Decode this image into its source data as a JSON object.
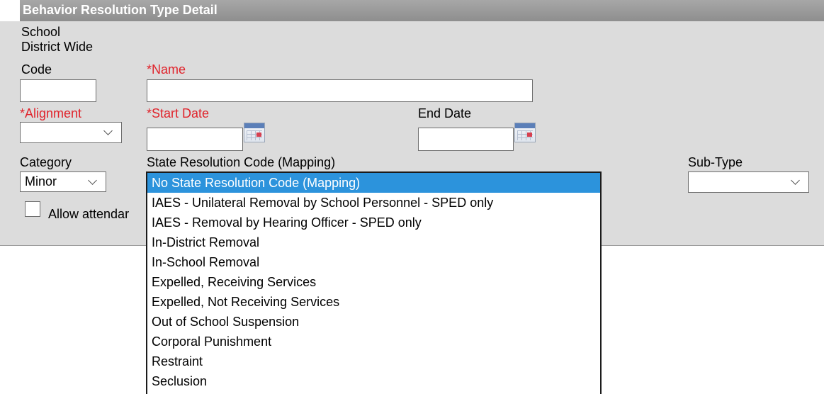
{
  "header": {
    "title": "Behavior Resolution Type Detail"
  },
  "info": {
    "school": "School",
    "district": "District Wide"
  },
  "fields": {
    "code": {
      "label": "Code",
      "value": ""
    },
    "name": {
      "label": "*Name",
      "value": ""
    },
    "alignment": {
      "label": "*Alignment",
      "value": ""
    },
    "start_date": {
      "label": "*Start Date",
      "value": ""
    },
    "end_date": {
      "label": "End Date",
      "value": ""
    },
    "category": {
      "label": "Category",
      "value": "Minor"
    },
    "state_code": {
      "label": "State Resolution Code (Mapping)"
    },
    "sub_type": {
      "label": "Sub-Type",
      "value": ""
    },
    "allow_attendance": {
      "label": "Allow attendar",
      "checked": false
    }
  },
  "dropdown": {
    "options": [
      "No State Resolution Code (Mapping)",
      "IAES - Unilateral Removal by School Personnel - SPED only",
      "IAES - Removal by Hearing Officer - SPED only",
      "In-District Removal",
      "In-School Removal",
      "Expelled, Receiving Services",
      "Expelled, Not Receiving Services",
      "Out of School Suspension",
      "Corporal Punishment",
      "Restraint",
      "Seclusion"
    ],
    "selected_index": 0
  },
  "colors": {
    "required": "#e0232b",
    "selection": "#2c93dc",
    "header": "#9a9a9a"
  },
  "icons": {
    "calendar": "calendar-icon",
    "chevron": "chevron-down-icon"
  }
}
